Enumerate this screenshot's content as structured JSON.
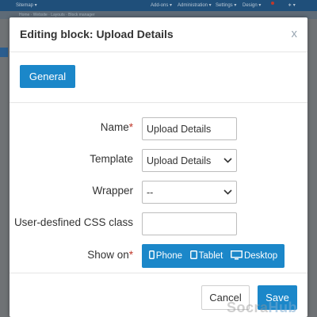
{
  "background": {
    "topbar_items": [
      "Sitemap ▾",
      "Add-ons ▾",
      "Administration ▾",
      "Settings ▾",
      "Design ▾",
      "∗ ▾"
    ],
    "crumbs": "Home · Website · Layouts · Block manager"
  },
  "modal": {
    "title": "Editing block: Upload Details",
    "close_label": "x",
    "tabs": [
      {
        "label": "General"
      }
    ],
    "fields": {
      "name": {
        "label": "Name",
        "value": "Upload Details",
        "required": "*"
      },
      "template": {
        "label": "Template",
        "value": "Upload Details"
      },
      "wrapper": {
        "label": "Wrapper",
        "value": "--"
      },
      "css_class": {
        "label": "User-desfined CSS class",
        "value": ""
      },
      "show_on": {
        "label": "Show on",
        "required": "*",
        "devices": [
          {
            "label": "Phone",
            "icon": "phone-icon"
          },
          {
            "label": "Tablet",
            "icon": "tablet-icon"
          },
          {
            "label": "Desktop",
            "icon": "desktop-icon"
          }
        ]
      }
    },
    "footer": {
      "cancel_label": "Cancel",
      "save_label": "Save"
    }
  },
  "watermark": {
    "part1": "Socra",
    "part2": "Hub"
  },
  "colors": {
    "accent": "#1b87c9",
    "required": "#c0392b",
    "overlay": "#6f7275"
  }
}
